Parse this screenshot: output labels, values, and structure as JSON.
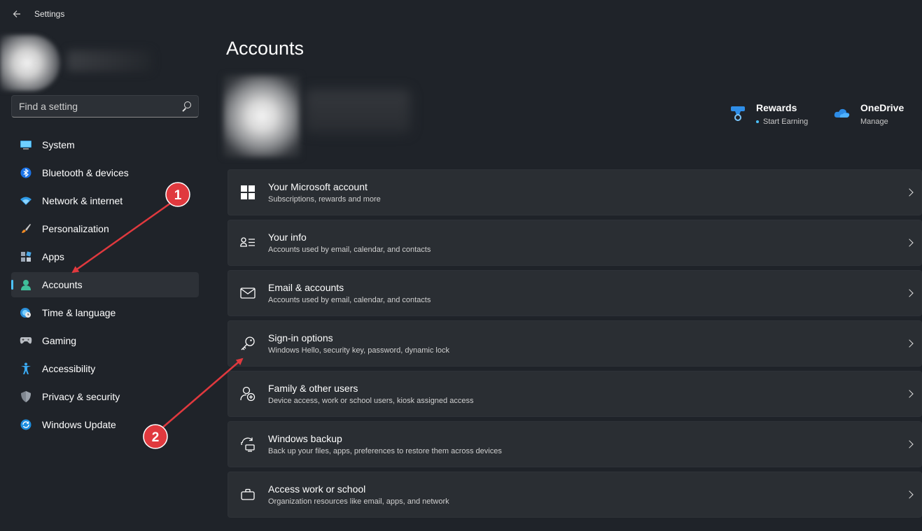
{
  "window": {
    "title": "Settings"
  },
  "search": {
    "placeholder": "Find a setting"
  },
  "sidebar": {
    "items": [
      {
        "label": "System",
        "icon": "monitor-icon"
      },
      {
        "label": "Bluetooth & devices",
        "icon": "bluetooth-icon"
      },
      {
        "label": "Network & internet",
        "icon": "wifi-icon"
      },
      {
        "label": "Personalization",
        "icon": "brush-icon"
      },
      {
        "label": "Apps",
        "icon": "apps-icon"
      },
      {
        "label": "Accounts",
        "icon": "person-icon",
        "active": true
      },
      {
        "label": "Time & language",
        "icon": "globe-clock-icon"
      },
      {
        "label": "Gaming",
        "icon": "gamepad-icon"
      },
      {
        "label": "Accessibility",
        "icon": "accessibility-icon"
      },
      {
        "label": "Privacy & security",
        "icon": "shield-icon"
      },
      {
        "label": "Windows Update",
        "icon": "update-icon"
      }
    ]
  },
  "main": {
    "title": "Accounts",
    "rewards": {
      "title": "Rewards",
      "subtitle": "Start Earning"
    },
    "onedrive": {
      "title": "OneDrive",
      "subtitle": "Manage"
    },
    "cards": [
      {
        "title": "Your Microsoft account",
        "subtitle": "Subscriptions, rewards and more",
        "icon": "windows-logo-icon"
      },
      {
        "title": "Your info",
        "subtitle": "Accounts used by email, calendar, and contacts",
        "icon": "contact-card-icon"
      },
      {
        "title": "Email & accounts",
        "subtitle": "Accounts used by email, calendar, and contacts",
        "icon": "mail-icon"
      },
      {
        "title": "Sign-in options",
        "subtitle": "Windows Hello, security key, password, dynamic lock",
        "icon": "key-icon"
      },
      {
        "title": "Family & other users",
        "subtitle": "Device access, work or school users, kiosk assigned access",
        "icon": "person-add-icon"
      },
      {
        "title": "Windows backup",
        "subtitle": "Back up your files, apps, preferences to restore them across devices",
        "icon": "backup-icon"
      },
      {
        "title": "Access work or school",
        "subtitle": "Organization resources like email, apps, and network",
        "icon": "briefcase-icon"
      }
    ]
  },
  "annotations": [
    {
      "number": "1"
    },
    {
      "number": "2"
    }
  ],
  "colors": {
    "accent": "#4cc2ff",
    "annotation": "#e0393e",
    "background": "#1f2329",
    "card": "#2a2e33"
  }
}
